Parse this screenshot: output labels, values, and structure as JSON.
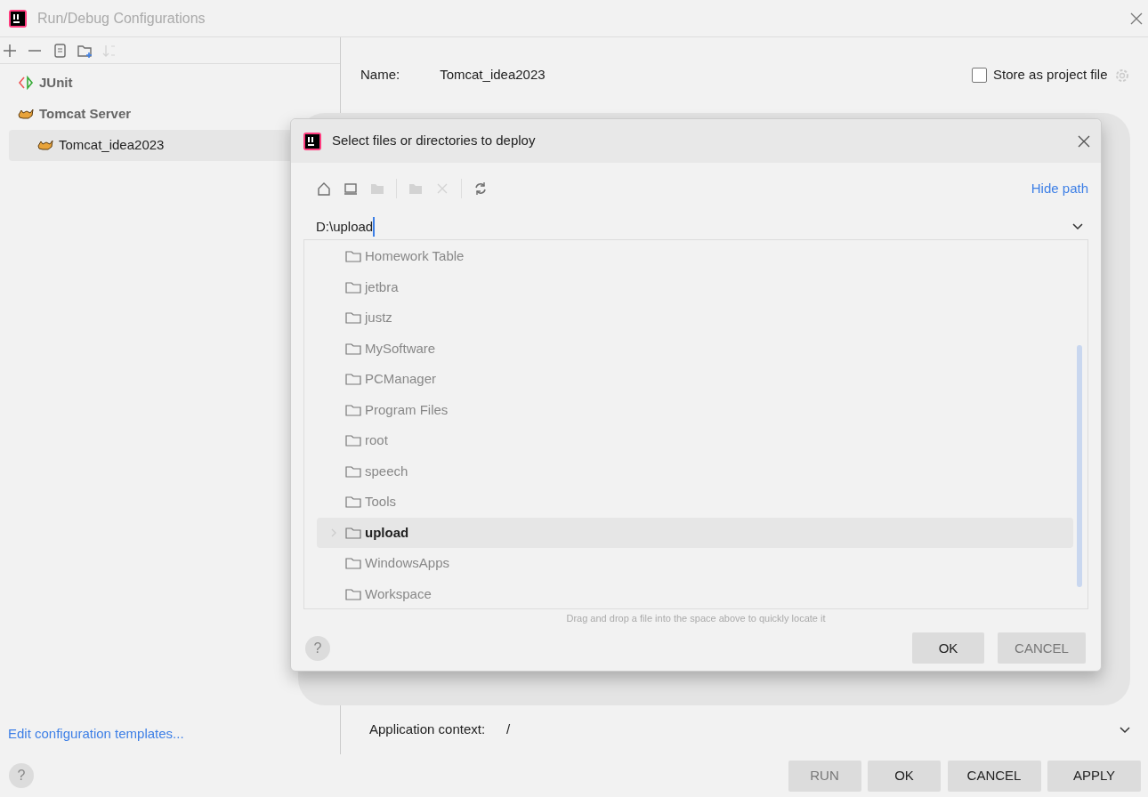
{
  "window": {
    "title": "Run/Debug Configurations"
  },
  "sidebar": {
    "toolbar": [
      {
        "kind": "add",
        "disabled": false
      },
      {
        "kind": "remove",
        "disabled": false
      },
      {
        "kind": "copy",
        "disabled": false
      },
      {
        "kind": "folder",
        "disabled": false
      },
      {
        "kind": "sort",
        "disabled": true
      }
    ],
    "tree": [
      {
        "label": "JUnit",
        "kind": "junit",
        "selected": false
      },
      {
        "label": "Tomcat Server",
        "kind": "tomcat",
        "selected": false,
        "children": [
          {
            "label": "Tomcat_idea2023",
            "kind": "tomcat",
            "selected": true
          }
        ]
      }
    ],
    "templates_link": "Edit configuration templates...",
    "help": "?"
  },
  "config": {
    "name_label": "Name:",
    "name_value": "Tomcat_idea2023",
    "store_label": "Store as project file",
    "store_checked": false,
    "context_label": "Application context:",
    "context_value": "/"
  },
  "buttons": [
    {
      "label": "RUN",
      "disabled": true
    },
    {
      "label": "OK",
      "disabled": false
    },
    {
      "label": "CANCEL",
      "disabled": false
    },
    {
      "label": "APPLY",
      "disabled": false
    }
  ],
  "dialog": {
    "title": "Select files or directories to deploy",
    "toolbar": [
      {
        "kind": "home",
        "disabled": false
      },
      {
        "kind": "desktop",
        "disabled": false
      },
      {
        "kind": "project",
        "disabled": true
      },
      {
        "kind": "newfolder",
        "disabled": true
      },
      {
        "kind": "delete",
        "disabled": true
      },
      {
        "kind": "refresh",
        "disabled": false
      }
    ],
    "hide_path": "Hide path",
    "path": "D:\\upload",
    "files": [
      {
        "name": "Homework Table",
        "selected": false
      },
      {
        "name": "jetbra",
        "selected": false
      },
      {
        "name": "justz",
        "selected": false
      },
      {
        "name": "MySoftware",
        "selected": false
      },
      {
        "name": "PCManager",
        "selected": false
      },
      {
        "name": "Program Files",
        "selected": false
      },
      {
        "name": "root",
        "selected": false
      },
      {
        "name": "speech",
        "selected": false
      },
      {
        "name": "Tools",
        "selected": false
      },
      {
        "name": "upload",
        "selected": true
      },
      {
        "name": "WindowsApps",
        "selected": false
      },
      {
        "name": "Workspace",
        "selected": false
      }
    ],
    "hint": "Drag and drop a file into the space above to quickly locate it",
    "help": "?",
    "buttons": [
      {
        "label": "OK",
        "disabled": false
      },
      {
        "label": "CANCEL",
        "disabled": true
      }
    ]
  }
}
